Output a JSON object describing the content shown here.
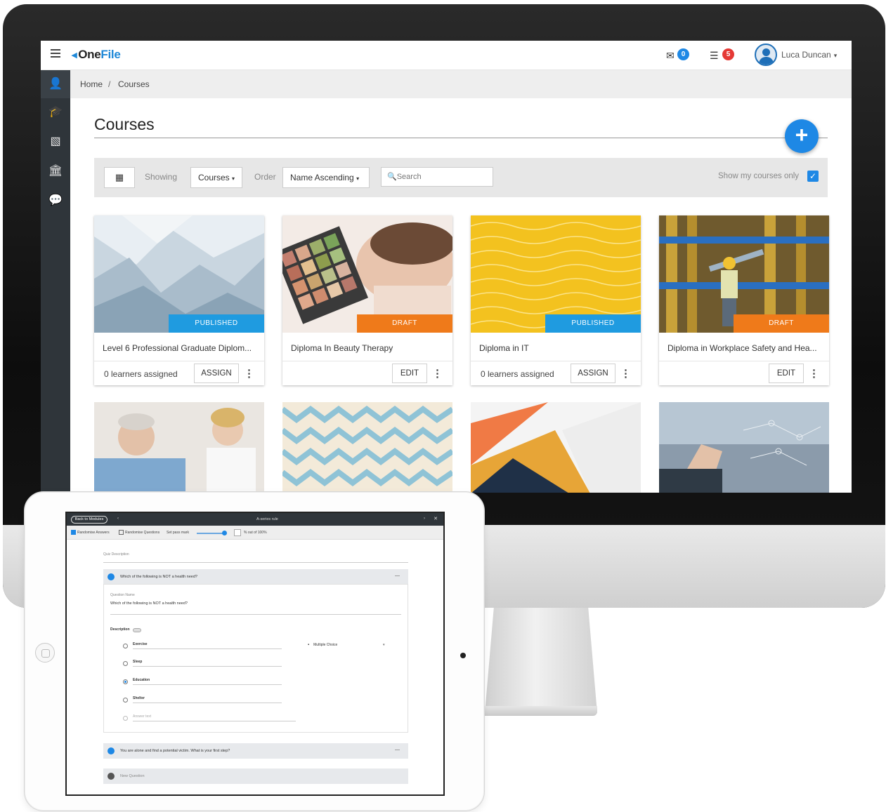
{
  "app": {
    "logo_mark": "◂",
    "logo_one": "One",
    "logo_file": "File",
    "mail_badge": "0",
    "tasks_badge": "5",
    "user_name": "Luca Duncan"
  },
  "breadcrumb": {
    "home": "Home",
    "sep": "/",
    "current": "Courses"
  },
  "page": {
    "title": "Courses",
    "fab": "+"
  },
  "filters": {
    "showing_label": "Showing",
    "showing_value": "Courses",
    "order_label": "Order",
    "order_value": "Name Ascending",
    "search_placeholder": "Search",
    "show_mine_label": "Show my courses only",
    "show_mine_checked": true
  },
  "courses": [
    {
      "title": "Level 6 Professional Graduate Diplom...",
      "status": "PUBLISHED",
      "learners": "0 learners assigned",
      "action": "ASSIGN"
    },
    {
      "title": "Diploma In Beauty Therapy",
      "status": "DRAFT",
      "learners": "",
      "action": "EDIT"
    },
    {
      "title": "Diploma in IT",
      "status": "PUBLISHED",
      "learners": "0 learners assigned",
      "action": "ASSIGN"
    },
    {
      "title": "Diploma in Workplace Safety and Hea...",
      "status": "DRAFT",
      "learners": "",
      "action": "EDIT"
    }
  ],
  "tablet": {
    "back_label": "Back to Modules",
    "window_title": "A-series rule",
    "opt_randomise_answers": "Randomise Answers",
    "opt_randomise_questions": "Randomise Questions",
    "opt_pass_mark": "Set pass mark",
    "opt_percent": "% out of 100%",
    "quiz_description_label": "Quiz Description",
    "q1_title": "Which of the following is NOT a health need?",
    "question_name_label": "Question Name",
    "question_name_value": "Which of the following is NOT a health need?",
    "description_label": "Description",
    "answer_type": "Multiple Choice",
    "answers": [
      "Exercise",
      "Sleep",
      "Education",
      "Shelter",
      "Answer text"
    ],
    "q2_title": "You are alone and find a potential victim. What is your first step?",
    "new_question": "New Question"
  }
}
